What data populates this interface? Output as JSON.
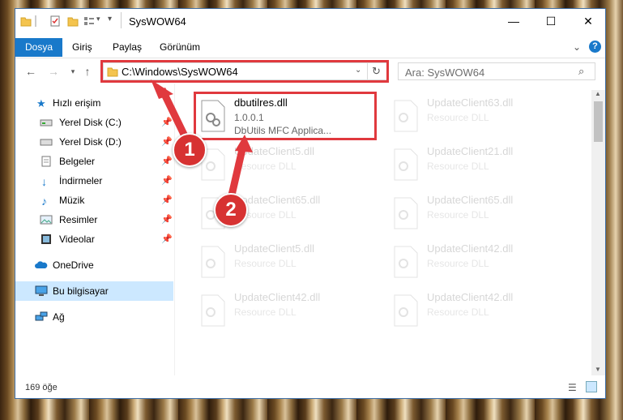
{
  "window": {
    "title": "SysWOW64",
    "minimize": "—",
    "maximize": "☐",
    "close": "✕"
  },
  "ribbon": {
    "tabs": [
      "Dosya",
      "Giriş",
      "Paylaş",
      "Görünüm"
    ],
    "expand_icon": "chevron-down-icon",
    "help_icon": "help-icon"
  },
  "navigation": {
    "address": "C:\\Windows\\SysWOW64",
    "search_placeholder": "Ara: SysWOW64"
  },
  "sidebar": {
    "items": [
      {
        "label": "Hızlı erişim",
        "icon": "star-icon"
      },
      {
        "label": "Yerel Disk (C:)",
        "icon": "drive-icon",
        "pinned": true
      },
      {
        "label": "Yerel Disk (D:)",
        "icon": "drive-icon",
        "pinned": true
      },
      {
        "label": "Belgeler",
        "icon": "documents-icon",
        "pinned": true
      },
      {
        "label": "İndirmeler",
        "icon": "download-icon",
        "pinned": true
      },
      {
        "label": "Müzik",
        "icon": "music-icon",
        "pinned": true
      },
      {
        "label": "Resimler",
        "icon": "pictures-icon",
        "pinned": true
      },
      {
        "label": "Videolar",
        "icon": "videos-icon",
        "pinned": true
      },
      {
        "label": "OneDrive",
        "icon": "cloud-icon"
      },
      {
        "label": "Bu bilgisayar",
        "icon": "computer-icon",
        "selected": true
      },
      {
        "label": "Ağ",
        "icon": "network-icon"
      }
    ]
  },
  "files": [
    {
      "name": "dbutilres.dll",
      "version": "1.0.0.1",
      "description": "DbUtils MFC Applica...",
      "highlighted": true
    },
    {
      "name": "UpdateClient63.dll",
      "description": "Resource DLL"
    },
    {
      "name": "UpdateClient5.dll",
      "description": "Resource DLL"
    },
    {
      "name": "UpdateClient21.dll",
      "description": "Resource DLL"
    },
    {
      "name": "UpdateClient65.dll",
      "description": "Resource DLL"
    },
    {
      "name": "UpdateClient65.dll",
      "description": "Resource DLL"
    },
    {
      "name": "UpdateClient5.dll",
      "description": "Resource DLL"
    },
    {
      "name": "UpdateClient42.dll",
      "description": "Resource DLL"
    },
    {
      "name": "UpdateClient42.dll",
      "description": "Resource DLL"
    },
    {
      "name": "UpdateClient42.dll",
      "description": "Resource DLL"
    }
  ],
  "status": {
    "count": "169 öğe"
  },
  "annotations": {
    "step1": "1",
    "step2": "2"
  },
  "colors": {
    "accent": "#1979ca",
    "highlight": "#e0393e",
    "selected_bg": "#cce8ff"
  }
}
